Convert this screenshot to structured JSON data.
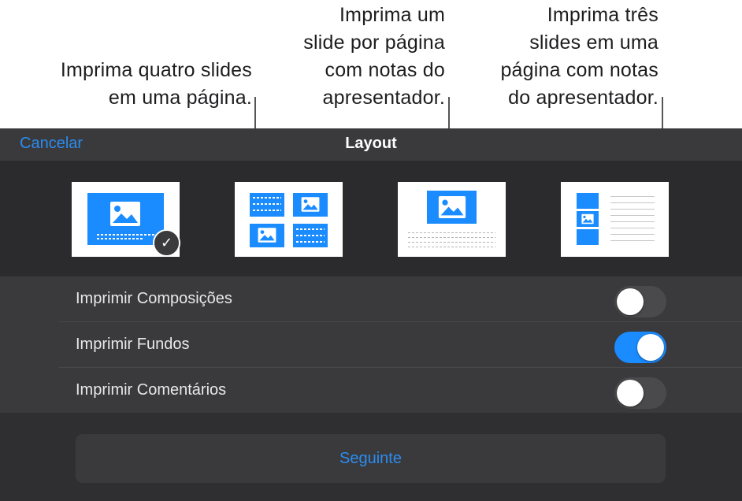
{
  "callouts": {
    "four_slides": "Imprima quatro slides\nem uma página.",
    "one_slide_notes": "Imprima um\nslide por página\ncom notas do\napresentador.",
    "three_slides_notes": "Imprima três\nslides em uma\npágina com notas\ndo apresentador."
  },
  "header": {
    "cancel_label": "Cancelar",
    "title": "Layout"
  },
  "layouts": [
    {
      "id": "one-slide",
      "selected": true
    },
    {
      "id": "four-slides",
      "selected": false
    },
    {
      "id": "one-slide-with-notes",
      "selected": false
    },
    {
      "id": "three-slides-with-notes",
      "selected": false
    }
  ],
  "options": [
    {
      "label": "Imprimir Composições",
      "on": false
    },
    {
      "label": "Imprimir Fundos",
      "on": true
    },
    {
      "label": "Imprimir Comentários",
      "on": false
    }
  ],
  "next_label": "Seguinte",
  "icons": {
    "selected": "checkmark-icon",
    "slide_picture": "image-icon"
  },
  "colors": {
    "accent": "#1a8cff",
    "link": "#2b8cf0",
    "sheet_bg": "#2f2f31"
  }
}
